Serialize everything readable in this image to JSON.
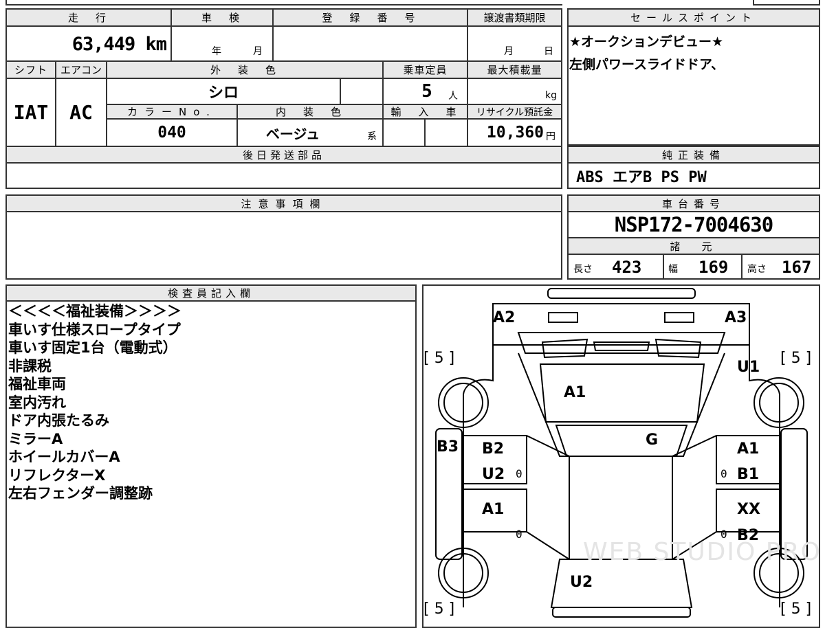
{
  "labels": {
    "mileage": "走　行",
    "inspection": "車　検",
    "registration": "登　録　番　号",
    "transfer_deadline": "譲渡書類期限",
    "sales_point": "セールスポイント",
    "shift": "シフト",
    "aircon": "エアコン",
    "exterior_color": "外　装　色",
    "capacity": "乗車定員",
    "max_load": "最大積載量",
    "color_no": "カラーNo.",
    "interior_color": "内　装　色",
    "import": "輸　入　車",
    "recycle_fee": "リサイクル預託金",
    "later_parts": "後日発送部品",
    "standard_equipment": "純正装備",
    "notes": "注意事項欄",
    "chassis_number": "車台番号",
    "specs": "諸　元",
    "inspector": "検査員記入欄"
  },
  "values": {
    "mileage": "63,449 km",
    "inspection_year_unit": "年",
    "inspection_month_unit": "月",
    "deadline_month_unit": "月",
    "deadline_day_unit": "日",
    "shift": "IAT",
    "aircon": "AC",
    "exterior_color": "シロ",
    "capacity": "5",
    "capacity_unit": "人",
    "max_load_unit": "kg",
    "color_no": "040",
    "interior_color": "ベージュ",
    "interior_suffix": "系",
    "recycle_fee": "10,360",
    "recycle_unit": "円",
    "standard_equipment": "ABS エアB PS PW",
    "chassis_number": "NSP172-7004630",
    "length_label": "長さ",
    "length": "423",
    "width_label": "幅",
    "width": "169",
    "height_label": "高さ",
    "height": "167"
  },
  "sales_points": [
    "★オークションデビュー★",
    "左側パワースライドドア、"
  ],
  "inspector_notes": [
    "＜＜＜＜福祉装備＞＞＞＞",
    "車いす仕様スロープタイプ",
    "車いす固定1台（電動式）",
    "非課税",
    "福祉車両",
    "室内汚れ",
    "ドア内張たるみ",
    "ミラーA",
    "ホイールカバーA",
    "リフレクターX",
    "左右フェンダー調整跡"
  ],
  "diagram": {
    "marks": {
      "a2": "A2",
      "a3": "A3",
      "u1": "U1",
      "a1_hood": "A1",
      "g": "G",
      "b3": "B3",
      "b2_left": "B2",
      "u2_left": "U2",
      "a1_left": "A1",
      "a1_right": "A1",
      "b1_right": "B1",
      "xx_right": "XX",
      "b2_right": "B2",
      "u2_rear": "U2"
    },
    "tire_tl": "[ 5 ]",
    "tire_tr": "[ 5 ]",
    "tire_bl": "[ 5 ]",
    "tire_br": "[ 5 ]",
    "zero": "0",
    "watermark": "WEB STUDIO PRO"
  }
}
